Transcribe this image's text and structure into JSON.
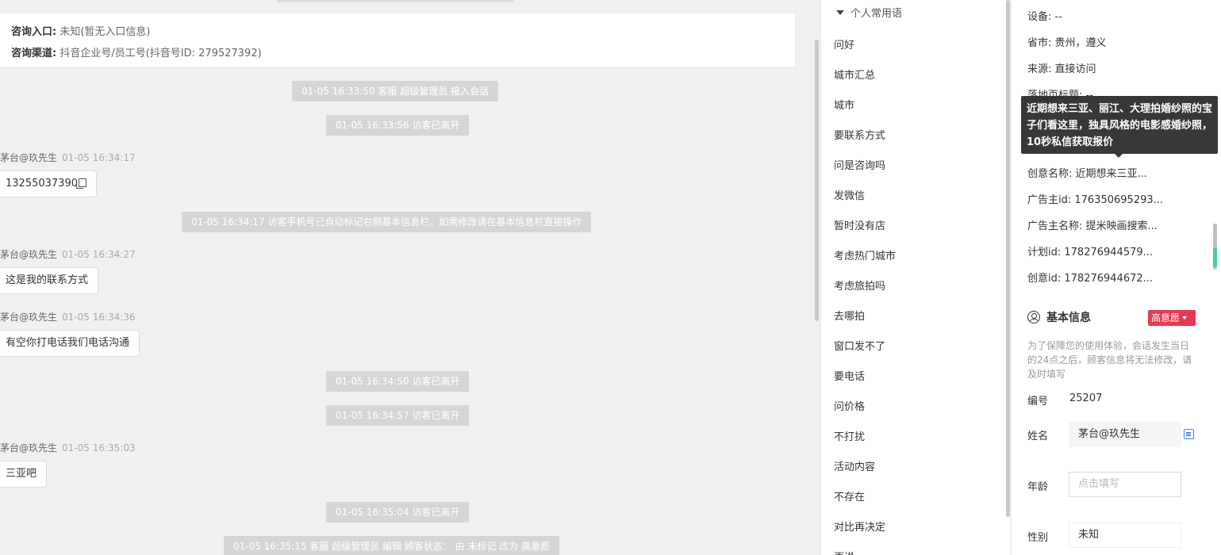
{
  "chat": {
    "entry_label": "咨询入口:",
    "entry_value": "未知(暂无入口信息)",
    "channel_label": "咨询渠道:",
    "channel_value": "抖音企业号/员工号(抖音号ID: 279527392)",
    "sys1": "01-05 16:33:50 客服 超级管理员 接入会话",
    "sys2": "01-05 16:33:56 访客已离开",
    "sender1": "茅台@玖先生",
    "time1": "01-05 16:34:17",
    "msg1": "13255037390",
    "sys3": "01-05 16:34:17 访客手机号已自动标记右侧基本信息栏，如需修改请在基本信息栏直接操作",
    "sender2": "茅台@玖先生",
    "time2": "01-05 16:34:27",
    "msg2": "这是我的联系方式",
    "sender3": "茅台@玖先生",
    "time3": "01-05 16:34:36",
    "msg3": "有空你打电话我们电话沟通",
    "sys4": "01-05 16:34:50 访客已离开",
    "sys5": "01-05 16:34:57 访客已离开",
    "sender4": "茅台@玖先生",
    "time4": "01-05 16:35:03",
    "msg4": "三亚吧",
    "sys6": "01-05 16:35:04 访客已离开",
    "sys7": "01-05 16:35:15 客服 超级管理员 编辑 顾客状态： 由 未标记 改为 高意愿"
  },
  "phrases": {
    "header": "个人常用语",
    "items": [
      "问好",
      "城市汇总",
      "城市",
      "要联系方式",
      "问是咨询吗",
      "发微信",
      "暂时没有店",
      "考虑热门城市",
      "考虑旅拍吗",
      "去哪拍",
      "窗口发不了",
      "要电话",
      "问价格",
      "不打扰",
      "活动内容",
      "不存在",
      "对比再决定",
      "再说"
    ]
  },
  "info": {
    "device_label": "设备:",
    "device_value": "--",
    "province_label": "省市:",
    "province_value": "贵州，遵义",
    "source_label": "来源:",
    "source_value": "直接访问",
    "landing_label": "落地页标题:",
    "landing_value": "--",
    "tooltip": "近期想来三亚、丽江、大理拍婚纱照的宝子们看这里，独具风格的电影感婚纱照，10秒私信获取报价",
    "creative_name_label": "创意名称:",
    "creative_name_value": "近期想来三亚...",
    "advertiser_id_label": "广告主id:",
    "advertiser_id_value": "176350695293...",
    "advertiser_name_label": "广告主名称:",
    "advertiser_name_value": "提米映画搜索...",
    "plan_id_label": "计划id:",
    "plan_id_value": "178276944579...",
    "creative_id_label": "创意id:",
    "creative_id_value": "178276944672...",
    "basic_title": "基本信息",
    "intent_badge": "高意愿",
    "notice": "为了保障您的使用体验，会话发生当日的24点之后，顾客信息将无法修改，请及时填写",
    "number_label": "编号",
    "number_value": "25207",
    "name_label": "姓名",
    "name_value": "茅台@玖先生",
    "age_label": "年龄",
    "age_placeholder": "点击填写",
    "gender_label": "性别",
    "gender_value": "未知"
  }
}
